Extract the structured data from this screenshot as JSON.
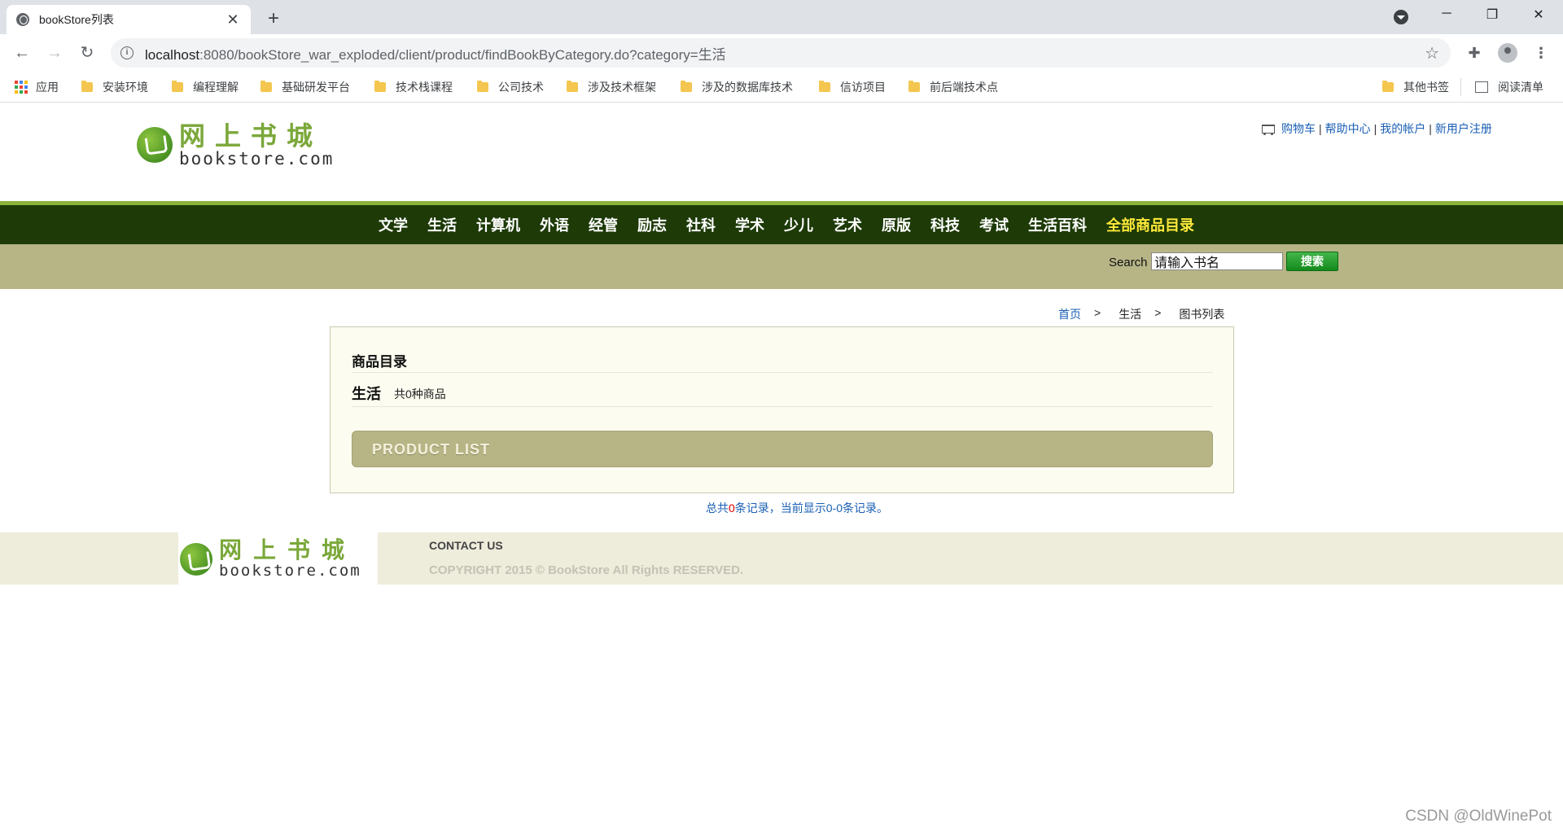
{
  "browser": {
    "tab_title": "bookStore列表",
    "url_host": "localhost",
    "url_rest": ":8080/bookStore_war_exploded/client/product/findBookByCategory.do?category=生活",
    "bookmarks": [
      "应用",
      "安装环境",
      "编程理解",
      "基础研发平台",
      "技术栈课程",
      "公司技术",
      "涉及技术框架",
      "涉及的数据库技术",
      "信访项目",
      "前后端技术点"
    ],
    "other_bookmarks": "其他书签",
    "reading_list": "阅读清单"
  },
  "header": {
    "logo_cn": "网上书城",
    "logo_en": "bookstore.com",
    "links": [
      "购物车",
      "帮助中心",
      "我的帐户",
      "新用户注册"
    ],
    "link_separator": "|"
  },
  "nav": {
    "items": [
      "文学",
      "生活",
      "计算机",
      "外语",
      "经管",
      "励志",
      "社科",
      "学术",
      "少儿",
      "艺术",
      "原版",
      "科技",
      "考试",
      "生活百科"
    ],
    "all_label": "全部商品目录"
  },
  "search": {
    "label": "Search",
    "placeholder": "请输入书名",
    "button": "搜索"
  },
  "breadcrumb": {
    "home": "首页",
    "sep": ">",
    "category": "生活",
    "page": "图书列表"
  },
  "catalog": {
    "title": "商品目录",
    "category": "生活",
    "count_text": "共0种商品",
    "product_list_label": "PRODUCT LIST"
  },
  "records": {
    "prefix": "总共",
    "total": "0",
    "suffix": "条记录，当前显示0-0条记录。"
  },
  "footer": {
    "contact": "CONTACT US",
    "copyright": "COPYRIGHT 2015 © BookStore All Rights RESERVED."
  },
  "watermark": "CSDN @OldWinePot",
  "colors": {
    "nav_bg": "#1d3a07",
    "accent_green": "#8cb33a",
    "search_bg": "#b7b586",
    "all_catalog": "#ffe93a",
    "link": "#1a5fb4"
  },
  "icons": [
    "globe-icon",
    "close-icon",
    "plus-icon",
    "back-arrow-icon",
    "forward-arrow-icon",
    "reload-icon",
    "info-icon",
    "star-icon",
    "puzzle-icon",
    "profile-icon",
    "more-icon",
    "apps-icon",
    "folder-icon",
    "reading-list-icon",
    "cart-icon"
  ]
}
